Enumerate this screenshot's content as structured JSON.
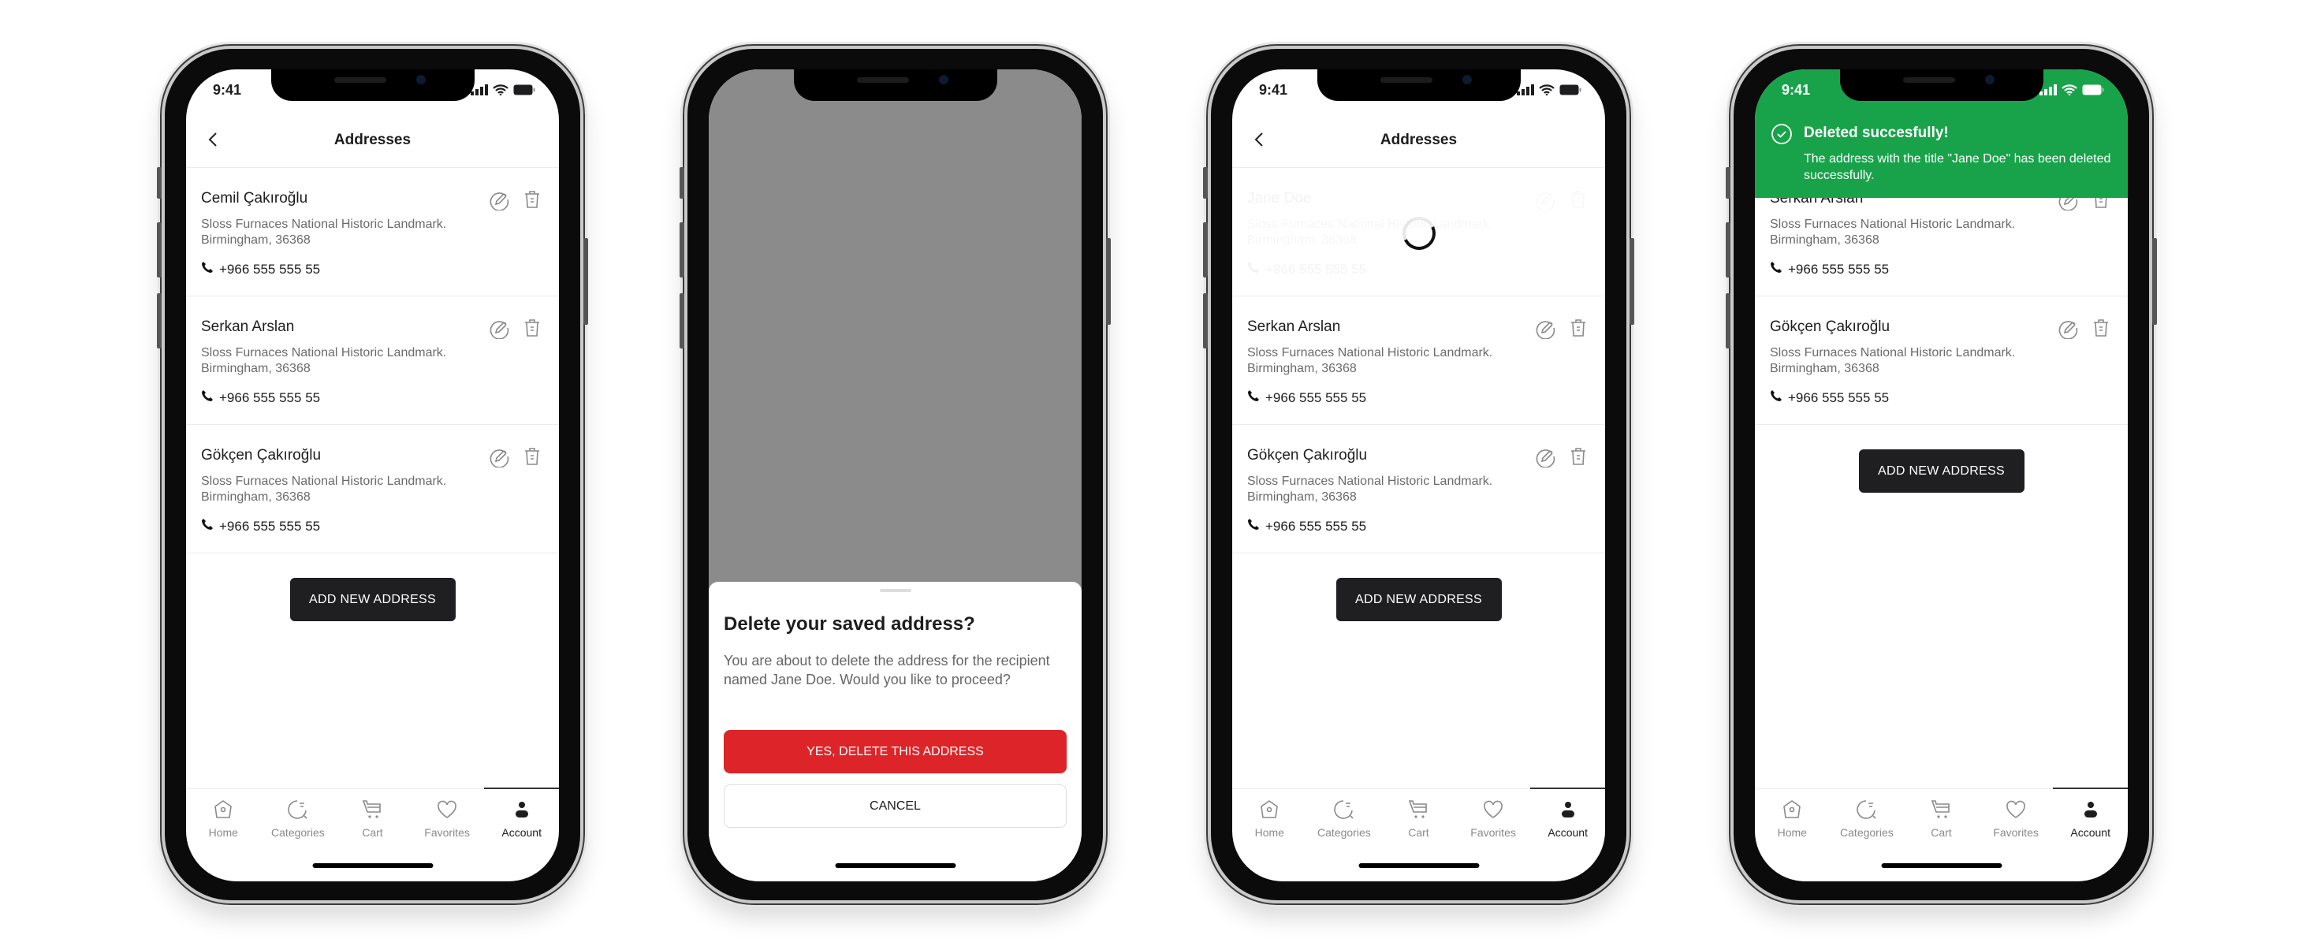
{
  "status": {
    "time": "9:41"
  },
  "header": {
    "title": "Addresses"
  },
  "addresses": [
    {
      "name": "Cemil Çakıroğlu",
      "line1": "Sloss Furnaces National Historic Landmark.",
      "line2": "Birmingham, 36368",
      "phone": "+966 555 555 55"
    },
    {
      "name": "Serkan Arslan",
      "line1": "Sloss Furnaces National Historic Landmark.",
      "line2": "Birmingham, 36368",
      "phone": "+966 555 555 55"
    },
    {
      "name": "Gökçen Çakıroğlu",
      "line1": "Sloss Furnaces National Historic Landmark.",
      "line2": "Birmingham, 36368",
      "phone": "+966 555 555 55"
    },
    {
      "name": "Jane Doe",
      "line1": "Sloss Furnaces National Historic Landmark.",
      "line2": "Birmingham, 36368",
      "phone": "+966 555 555 55"
    }
  ],
  "add_button": "ADD NEW ADDRESS",
  "tabs": [
    {
      "label": "Home",
      "icon": "home-icon"
    },
    {
      "label": "Categories",
      "icon": "categories-icon"
    },
    {
      "label": "Cart",
      "icon": "cart-icon"
    },
    {
      "label": "Favorites",
      "icon": "heart-icon"
    },
    {
      "label": "Account",
      "icon": "account-icon",
      "active": true
    }
  ],
  "dialog": {
    "title": "Delete your saved address?",
    "body": "You are about to delete the address for the recipient named Jane Doe. Would you like to proceed?",
    "confirm": "YES, DELETE THIS ADDRESS",
    "cancel": "CANCEL"
  },
  "toast": {
    "title": "Deleted succesfully!",
    "body": "The address with the title \"Jane Doe\" has been deleted successfully."
  },
  "colors": {
    "danger": "#dd2428",
    "success": "#18a34a",
    "primary": "#1f1f22",
    "overlay": "#8b8b8b"
  }
}
